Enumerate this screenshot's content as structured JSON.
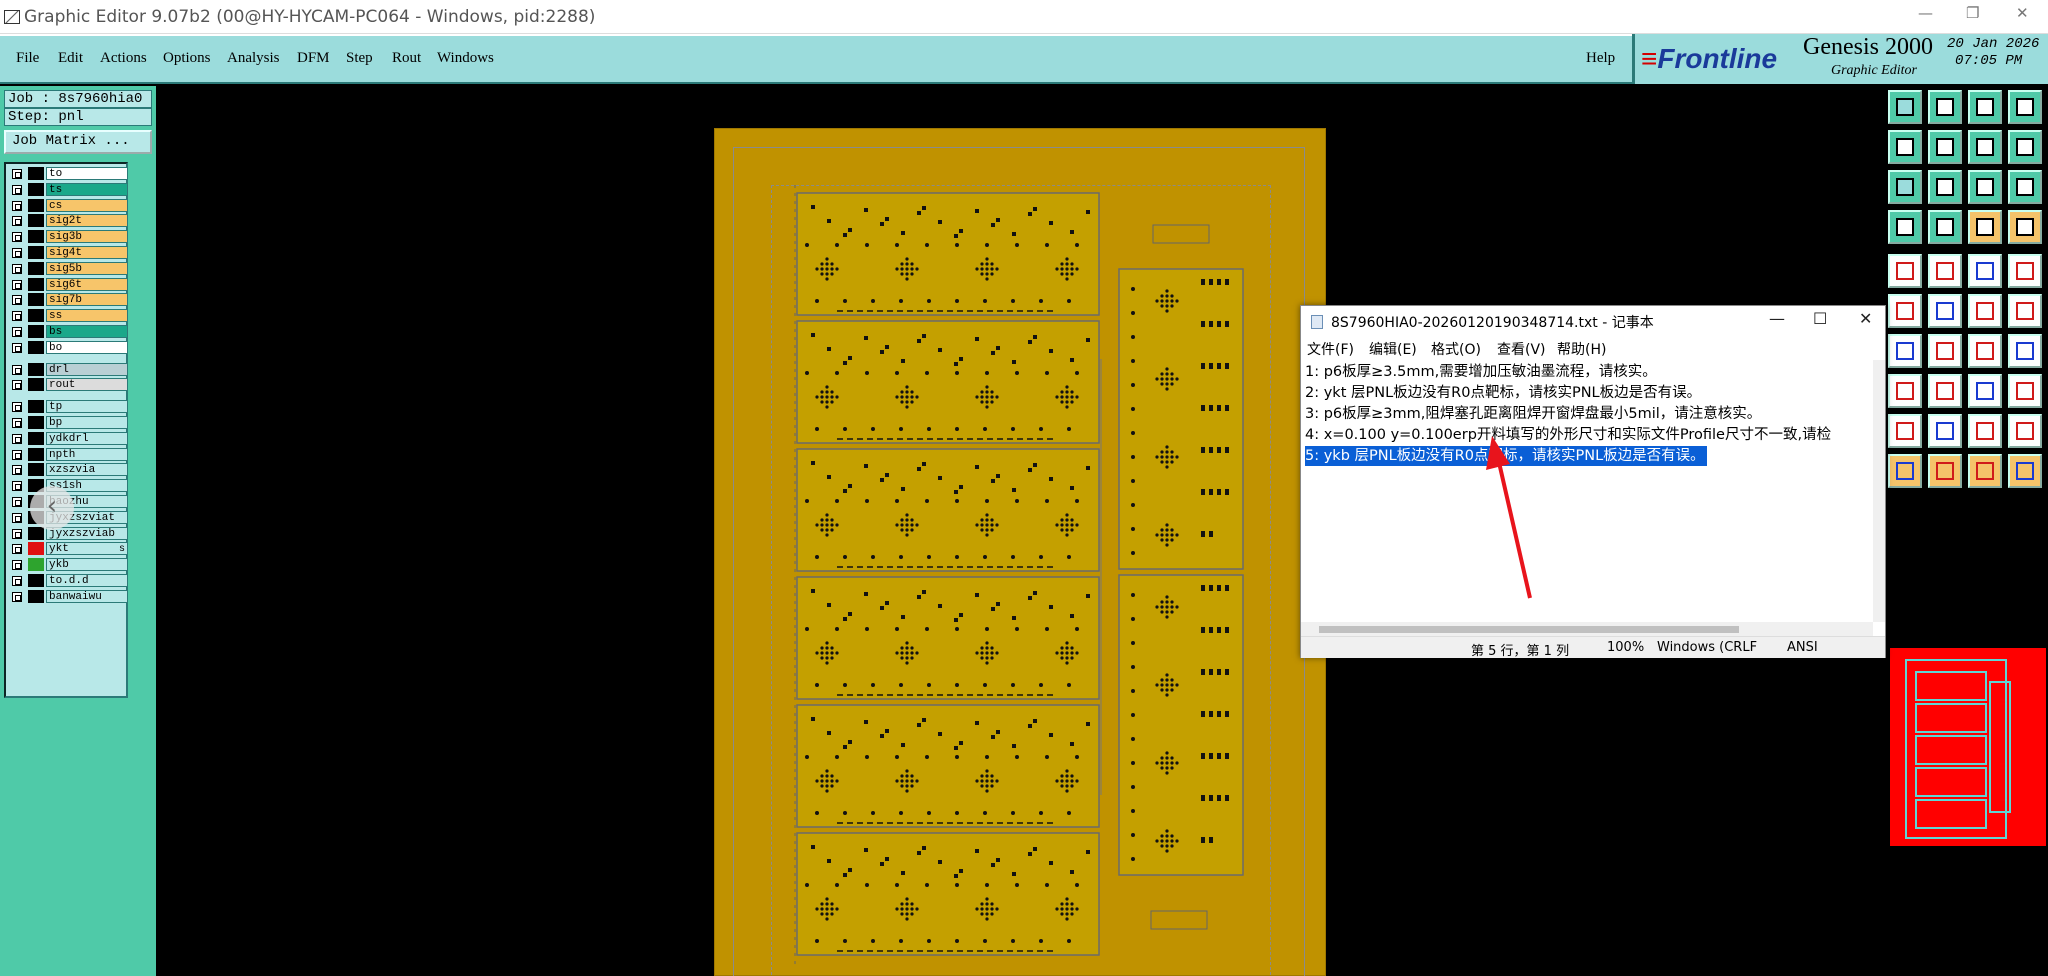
{
  "window": {
    "title": "Graphic Editor 9.07b2 (00@HY-HYCAM-PC064 - Windows, pid:2288)",
    "minimize": "—",
    "restore": "❐",
    "close": "✕"
  },
  "menu": {
    "items": [
      "File",
      "Edit",
      "Actions",
      "Options",
      "Analysis",
      "DFM",
      "Step",
      "Rout",
      "Windows"
    ],
    "help": "Help"
  },
  "brand": {
    "logo": "Frontline",
    "product": "Genesis 2000",
    "subtitle": "Graphic Editor",
    "date": "20 Jan 2026",
    "time": "07:05 PM"
  },
  "job": {
    "job_label": "Job : 8s7960hia0",
    "step_label": "Step: pnl",
    "matrix_button": "Job Matrix ..."
  },
  "layers": [
    {
      "name": "to",
      "color": "#ffffff",
      "swatch": "#000000"
    },
    {
      "name": "ts",
      "color": "#1aa88a",
      "swatch": "#000000"
    },
    {
      "name": "cs",
      "color": "#f7c56a",
      "swatch": "#000000"
    },
    {
      "name": "sig2t",
      "color": "#f7c56a",
      "swatch": "#000000"
    },
    {
      "name": "sig3b",
      "color": "#f7c56a",
      "swatch": "#000000"
    },
    {
      "name": "sig4t",
      "color": "#f7c56a",
      "swatch": "#000000"
    },
    {
      "name": "sig5b",
      "color": "#f7c56a",
      "swatch": "#000000"
    },
    {
      "name": "sig6t",
      "color": "#f7c56a",
      "swatch": "#000000"
    },
    {
      "name": "sig7b",
      "color": "#f7c56a",
      "swatch": "#000000"
    },
    {
      "name": "ss",
      "color": "#f7c56a",
      "swatch": "#000000"
    },
    {
      "name": "bs",
      "color": "#1aa88a",
      "swatch": "#000000"
    },
    {
      "name": "bo",
      "color": "#ffffff",
      "swatch": "#000000"
    },
    {
      "name": "drl",
      "color": "#b8cfd4",
      "swatch": "#000000"
    },
    {
      "name": "rout",
      "color": "#dcdcdc",
      "swatch": "#000000"
    },
    {
      "name": "tp",
      "color": "#b8e8e8",
      "swatch": "#000000"
    },
    {
      "name": "bp",
      "color": "#b8e8e8",
      "swatch": "#000000"
    },
    {
      "name": "ydkdrl",
      "color": "#b8e8e8",
      "swatch": "#000000"
    },
    {
      "name": "npth",
      "color": "#b8e8e8",
      "swatch": "#000000"
    },
    {
      "name": "xzszvia",
      "color": "#b8e8e8",
      "swatch": "#000000"
    },
    {
      "name": "ss1sh",
      "color": "#b8e8e8",
      "swatch": "#000000"
    },
    {
      "name": "baozhu",
      "color": "#b8e8e8",
      "swatch": "#000000"
    },
    {
      "name": "jyxzszviat",
      "color": "#b8e8e8",
      "swatch": "#000000"
    },
    {
      "name": "jyxzszviab",
      "color": "#b8e8e8",
      "swatch": "#000000"
    },
    {
      "name": "ykt",
      "color": "#b8e8e8",
      "swatch": "#e01010",
      "mark": "s"
    },
    {
      "name": "ykb",
      "color": "#b8e8e8",
      "swatch": "#2ea42e"
    },
    {
      "name": "to.d.d",
      "color": "#b8e8e8",
      "swatch": "#000000"
    },
    {
      "name": "banwaiwu",
      "color": "#b8e8e8",
      "swatch": "#000000"
    }
  ],
  "nav": {
    "prev": "‹",
    "next": "›"
  },
  "notepad": {
    "title": "8S7960HIA0-20260120190348714.txt - 记事本",
    "menu": [
      "文件(F)",
      "编辑(E)",
      "格式(O)",
      "查看(V)",
      "帮助(H)"
    ],
    "lines": [
      "1:  p6板厚≥3.5mm,需要增加压敏油墨流程，请核实。",
      "2:  ykt 层PNL板边没有R0点靶标，请核实PNL板边是否有误。",
      "3:  p6板厚≥3mm,阻焊塞孔距离阻焊开窗焊盘最小5mil，请注意核实。",
      "4:  x=0.100 y=0.100erp开料填写的外形尺寸和实际文件Profile尺寸不一致,请检",
      "5:  ykb 层PNL板边没有R0点靶标，请核实PNL板边是否有误。"
    ],
    "selected_line": 4,
    "status": {
      "position": "第 5 行，第 1 列",
      "zoom": "100%",
      "eol": "Windows (CRLF",
      "encoding": "ANSI"
    },
    "minimize": "—",
    "maximize": "☐",
    "close": "✕"
  },
  "colors": {
    "menu_bg": "#9bdcdc",
    "panel_bg": "#4fcaa8",
    "board": "#c09200",
    "selection": "#0a5fd6",
    "arrow": "#e8141c"
  }
}
